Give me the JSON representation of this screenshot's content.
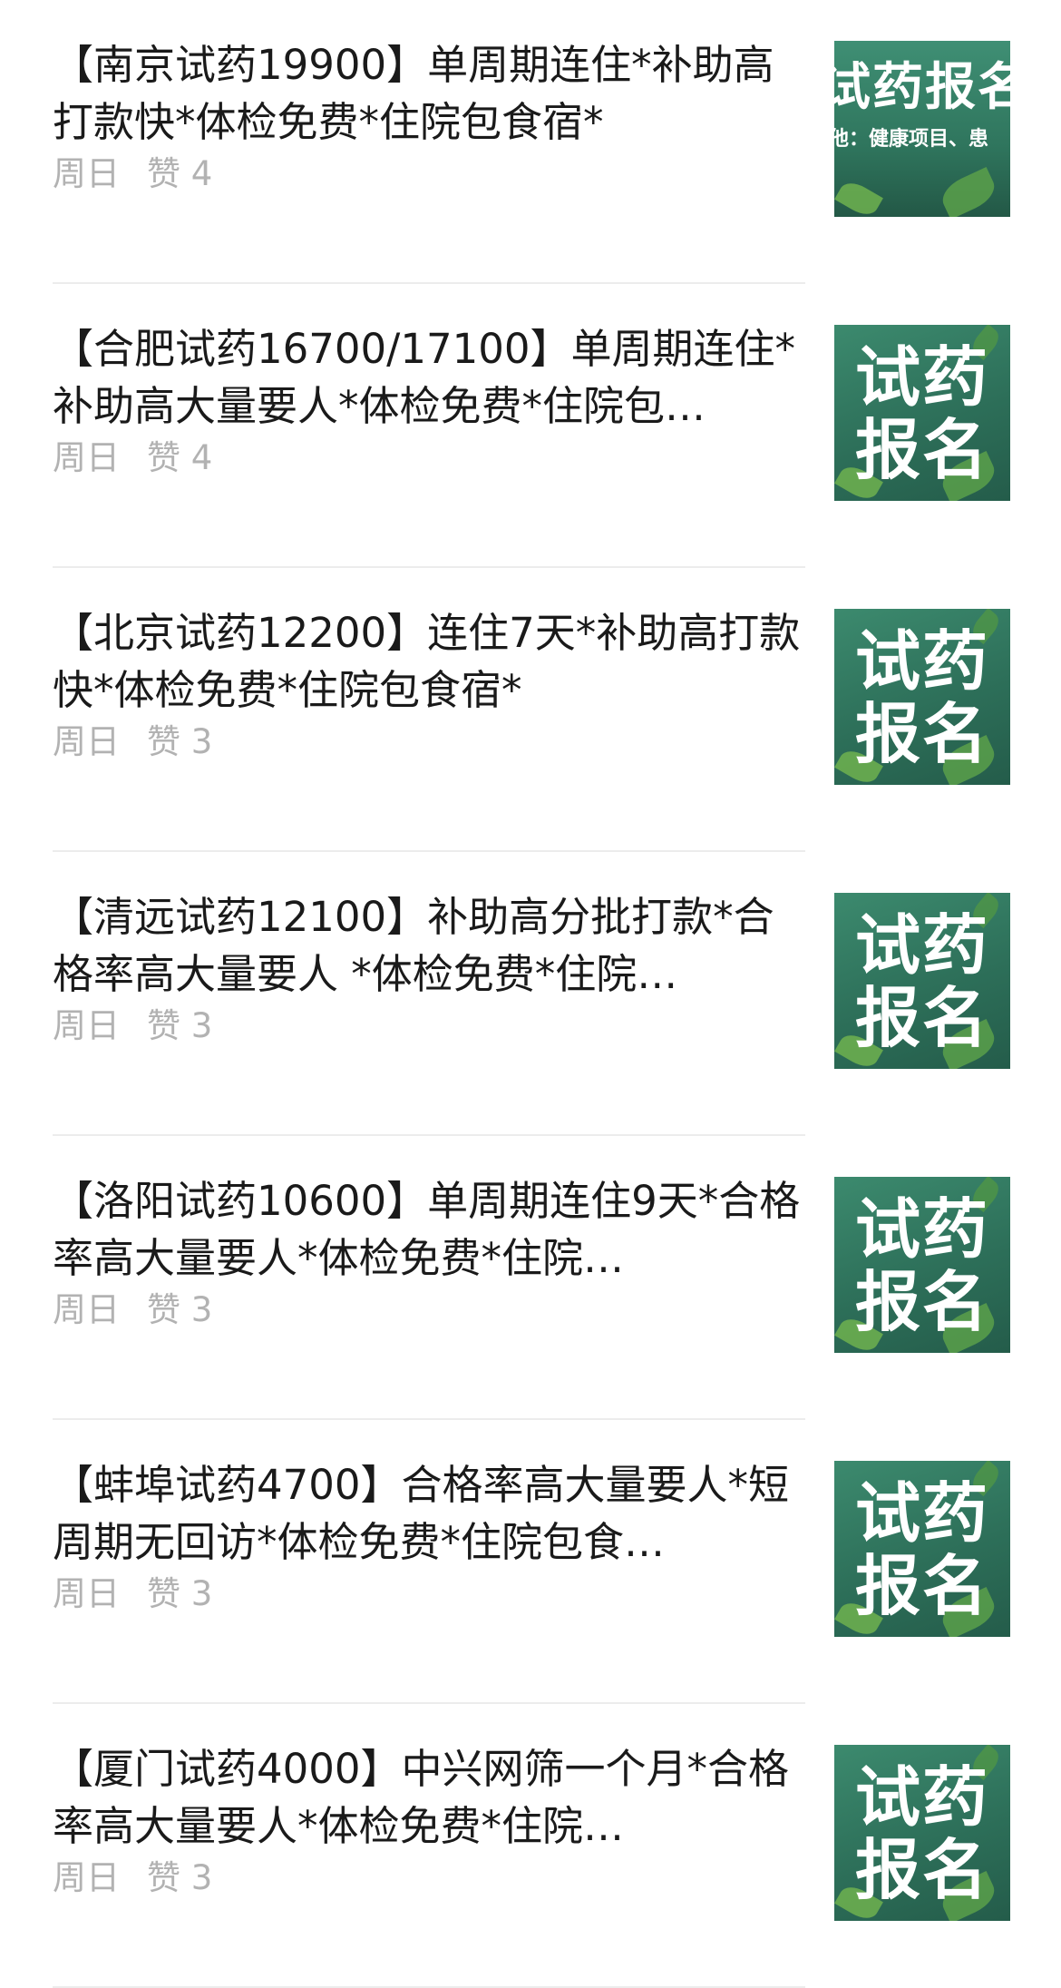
{
  "articles": [
    {
      "title": "【南京试药19900】单周期连住*补助高打款快*体检免费*住院包食宿*",
      "date": "周日",
      "likes": "赞 4",
      "thumb_text": "试药报名",
      "thumb_sub": "他：健康项目、患"
    },
    {
      "title": "【合肥试药16700/17100】单周期连住*补助高大量要人*体检免费*住院包…",
      "date": "周日",
      "likes": "赞 4",
      "thumb_line1": "试药",
      "thumb_line2": "报名"
    },
    {
      "title": "【北京试药12200】连住7天*补助高打款快*体检免费*住院包食宿*",
      "date": "周日",
      "likes": "赞 3",
      "thumb_line1": "试药",
      "thumb_line2": "报名"
    },
    {
      "title": "【清远试药12100】补助高分批打款*合格率高大量要人 *体检免费*住院…",
      "date": "周日",
      "likes": "赞 3",
      "thumb_line1": "试药",
      "thumb_line2": "报名"
    },
    {
      "title": "【洛阳试药10600】单周期连住9天*合格率高大量要人*体检免费*住院…",
      "date": "周日",
      "likes": "赞 3",
      "thumb_line1": "试药",
      "thumb_line2": "报名"
    },
    {
      "title": "【蚌埠试药4700】合格率高大量要人*短周期无回访*体检免费*住院包食…",
      "date": "周日",
      "likes": "赞 3",
      "thumb_line1": "试药",
      "thumb_line2": "报名"
    },
    {
      "title": "【厦门试药4000】中兴网筛一个月*合格率高大量要人*体检免费*住院…",
      "date": "周日",
      "likes": "赞 3",
      "thumb_line1": "试药",
      "thumb_line2": "报名"
    }
  ]
}
